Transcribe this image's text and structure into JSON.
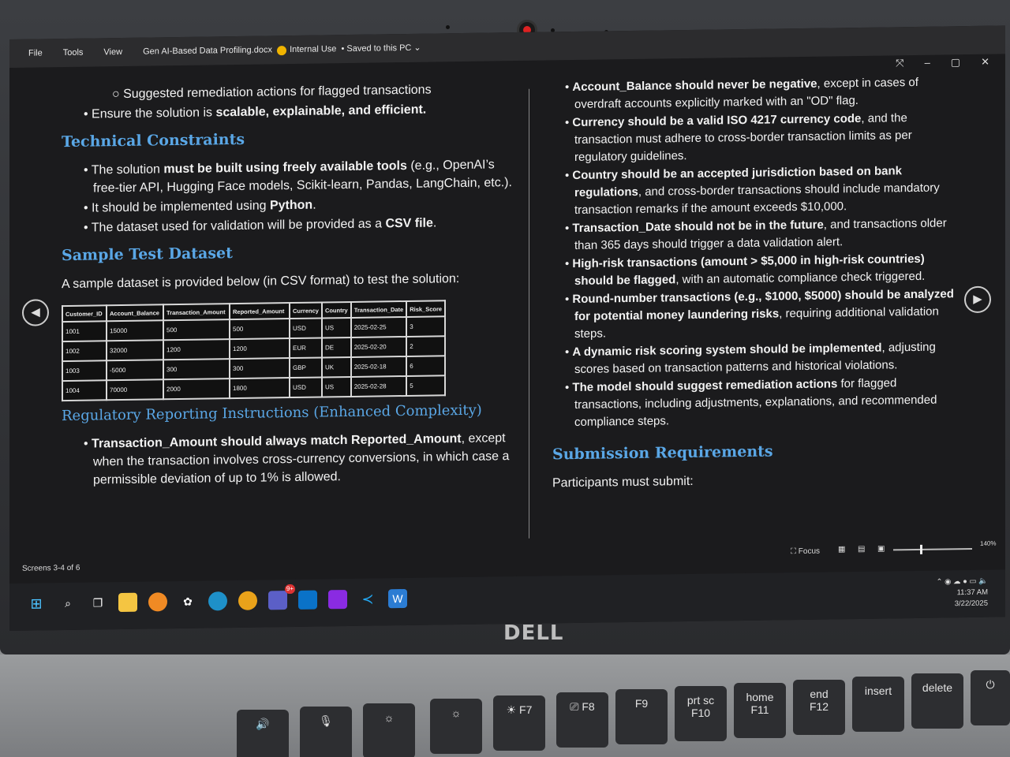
{
  "menubar": {
    "file": "File",
    "tools": "Tools",
    "view": "View",
    "doc_title": "Gen AI-Based Data Profiling.docx",
    "label": "Internal Use",
    "save_state": "Saved to this PC"
  },
  "left": {
    "sub_bullet": "Suggested remediation actions for flagged transactions",
    "bullet_scalable_prefix": "Ensure the solution is ",
    "bullet_scalable_bold": "scalable, explainable, and efficient.",
    "heading_constraints": "Technical Constraints",
    "constraint_1_prefix": "The solution ",
    "constraint_1_bold": "must be built using freely available tools",
    "constraint_1_rest": " (e.g., OpenAI’s free-tier API, Hugging Face models, Scikit-learn, Pandas, LangChain, etc.).",
    "constraint_2_prefix": "It should be implemented using ",
    "constraint_2_bold": "Python",
    "constraint_2_suffix": ".",
    "constraint_3_prefix": "The dataset used for validation will be provided as a ",
    "constraint_3_bold": "CSV file",
    "constraint_3_suffix": ".",
    "heading_dataset": "Sample Test Dataset",
    "dataset_intro": "A sample dataset is provided below (in CSV format) to test the solution:",
    "table": {
      "headers": [
        "Customer_ID",
        "Account_Balance",
        "Transaction_Amount",
        "Reported_Amount",
        "Currency",
        "Country",
        "Transaction_Date",
        "Risk_Score"
      ],
      "rows": [
        [
          "1001",
          "15000",
          "500",
          "500",
          "USD",
          "US",
          "2025-02-25",
          "3"
        ],
        [
          "1002",
          "32000",
          "1200",
          "1200",
          "EUR",
          "DE",
          "2025-02-20",
          "2"
        ],
        [
          "1003",
          "-5000",
          "300",
          "300",
          "GBP",
          "UK",
          "2025-02-18",
          "6"
        ],
        [
          "1004",
          "70000",
          "2000",
          "1800",
          "USD",
          "US",
          "2025-02-28",
          "5"
        ]
      ]
    },
    "heading_regulatory": "Regulatory Reporting Instructions (Enhanced Complexity)",
    "reg_1_bold": "Transaction_Amount should always match Reported_Amount",
    "reg_1_rest": ", except when the transaction involves cross-currency conversions, in which case a permissible deviation of up to 1% is allowed."
  },
  "right": {
    "r1_bold": "Account_Balance should never be negative",
    "r1_rest": ", except in cases of overdraft accounts explicitly marked with an \"OD\" flag.",
    "r2_bold": "Currency should be a valid ISO 4217 currency code",
    "r2_rest": ", and the transaction must adhere to cross-border transaction limits as per regulatory guidelines.",
    "r3_bold": "Country should be an accepted jurisdiction based on bank regulations",
    "r3_rest": ", and cross-border transactions should include mandatory transaction remarks if the amount exceeds $10,000.",
    "r4_bold": "Transaction_Date should not be in the future",
    "r4_rest": ", and transactions older than 365 days should trigger a data validation alert.",
    "r5_bold": "High-risk transactions (amount > $5,000 in high-risk countries) should be flagged",
    "r5_rest": ", with an automatic compliance check triggered.",
    "r6_bold": "Round-number transactions (e.g., $1000, $5000) should be analyzed for potential money laundering risks",
    "r6_rest": ", requiring additional validation steps.",
    "r7_bold": "A dynamic risk scoring system should be implemented",
    "r7_rest": ", adjusting scores based on transaction patterns and historical violations.",
    "r8_bold": "The model should suggest remediation actions",
    "r8_rest": " for flagged transactions, including adjustments, explanations, and recommended compliance steps.",
    "heading_submission": "Submission Requirements",
    "submission_text": "Participants must submit:"
  },
  "statusbar": {
    "screens": "Screens 3-4 of 6",
    "focus": "Focus",
    "zoom": "140%"
  },
  "tray": {
    "time": "11:37 AM",
    "date": "3/22/2025",
    "badge": "9+"
  },
  "brand": "DELL",
  "keys": {
    "f7": "F7",
    "f8": "F8",
    "f9": "F9",
    "prtsc": "prt sc",
    "f10": "F10",
    "home": "home",
    "f11": "F11",
    "end": "end",
    "f12": "F12",
    "insert": "insert",
    "delete": "delete"
  }
}
